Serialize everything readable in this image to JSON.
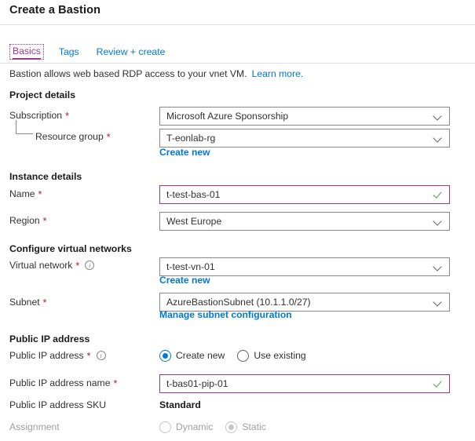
{
  "header": {
    "title": "Create a Bastion"
  },
  "tabs": [
    {
      "label": "Basics",
      "selected": true
    },
    {
      "label": "Tags",
      "selected": false
    },
    {
      "label": "Review + create",
      "selected": false
    }
  ],
  "intro": {
    "text": "Bastion allows web based RDP access to your vnet VM.",
    "link": "Learn more."
  },
  "sections": {
    "project_details": {
      "heading": "Project details",
      "subscription": {
        "label": "Subscription",
        "required": "*",
        "value": "Microsoft Azure Sponsorship",
        "icon": "chevron-down-icon"
      },
      "resource_group": {
        "label": "Resource group",
        "required": "*",
        "value": "T-eonlab-rg",
        "icon": "chevron-down-icon",
        "create_new": "Create new"
      }
    },
    "instance_details": {
      "heading": "Instance details",
      "name": {
        "label": "Name",
        "required": "*",
        "value": "t-test-bas-01",
        "icon": "checkmark-icon"
      },
      "region": {
        "label": "Region",
        "required": "*",
        "value": "West Europe",
        "icon": "chevron-down-icon"
      }
    },
    "configure_virtual_networks": {
      "heading": "Configure virtual networks",
      "virtual_network": {
        "label": "Virtual network",
        "required": "*",
        "info": "i",
        "value": "t-test-vn-01",
        "icon": "chevron-down-icon",
        "create_new": "Create new"
      },
      "subnet": {
        "label": "Subnet",
        "required": "*",
        "value": "AzureBastionSubnet (10.1.1.0/27)",
        "icon": "chevron-down-icon",
        "manage_link": "Manage subnet configuration"
      }
    },
    "public_ip_address": {
      "heading": "Public IP address",
      "public_ip_address": {
        "label": "Public IP address",
        "required": "*",
        "info": "i",
        "options": [
          {
            "label": "Create new",
            "checked": true
          },
          {
            "label": "Use existing",
            "checked": false
          }
        ]
      },
      "public_ip_address_name": {
        "label": "Public IP address name",
        "required": "*",
        "value": "t-bas01-pip-01",
        "icon": "checkmark-icon"
      },
      "public_ip_address_sku": {
        "label": "Public IP address SKU",
        "value": "Standard"
      },
      "assignment": {
        "label": "Assignment",
        "disabled": true,
        "options": [
          {
            "label": "Dynamic",
            "checked": false
          },
          {
            "label": "Static",
            "checked": true
          }
        ]
      }
    }
  },
  "colors": {
    "accent_link": "#0078d4",
    "selected_tab": "#a4368a",
    "required_asterisk": "#a4262c",
    "valid_border": "#a4368a",
    "valid_check": "#4a9e4a",
    "border": "#8a8886",
    "disabled_text": "#a19f9d"
  }
}
